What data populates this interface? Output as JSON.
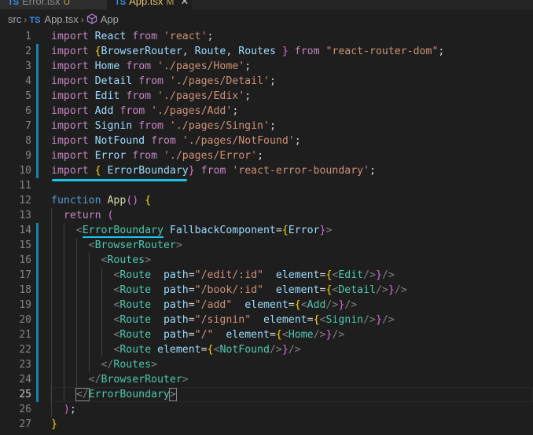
{
  "tabs": [
    {
      "label": "Error.tsx",
      "badge": "U",
      "active": false
    },
    {
      "label": "App.tsx",
      "badge": "M",
      "active": true
    }
  ],
  "breadcrumb": {
    "folder": "src",
    "file_badge": "TS",
    "file": "App.tsx",
    "symbol": "App"
  },
  "editor": {
    "current_line": 25,
    "lines": [
      {
        "n": "1",
        "text": "import React from 'react';"
      },
      {
        "n": "2",
        "text": "import {BrowserRouter, Route, Routes } from \"react-router-dom\";"
      },
      {
        "n": "3",
        "text": "import Home from './pages/Home';"
      },
      {
        "n": "4",
        "text": "import Detail from './pages/Detail';"
      },
      {
        "n": "5",
        "text": "import Edit from './pages/Edix';"
      },
      {
        "n": "6",
        "text": "import Add from './pages/Add';"
      },
      {
        "n": "7",
        "text": "import Signin from './pages/Singin';"
      },
      {
        "n": "8",
        "text": "import NotFound from './pages/NotFound';"
      },
      {
        "n": "9",
        "text": "import Error from './pages/Error';"
      },
      {
        "n": "10",
        "text": "import { ErrorBoundary} from 'react-error-boundary';"
      },
      {
        "n": "11",
        "text": ""
      },
      {
        "n": "12",
        "text": "function App() {"
      },
      {
        "n": "13",
        "text": "  return ("
      },
      {
        "n": "14",
        "text": "    <ErrorBoundary FallbackComponent={Error}>"
      },
      {
        "n": "15",
        "text": "      <BrowserRouter>"
      },
      {
        "n": "16",
        "text": "        <Routes>"
      },
      {
        "n": "17",
        "text": "          <Route  path=\"/edit/:id\"  element={<Edit/>}/>"
      },
      {
        "n": "18",
        "text": "          <Route  path=\"/book/:id\"  element={<Detail/>}/>"
      },
      {
        "n": "19",
        "text": "          <Route  path=\"/add\"  element={<Add/>}/>"
      },
      {
        "n": "20",
        "text": "          <Route  path=\"/signin\"  element={<Signin/>}/>"
      },
      {
        "n": "21",
        "text": "          <Route  path=\"/\"  element={<Home/>}/>"
      },
      {
        "n": "22",
        "text": "          <Route element={<NotFound/>}/>"
      },
      {
        "n": "23",
        "text": "        </Routes>"
      },
      {
        "n": "24",
        "text": "      </BrowserRouter>"
      },
      {
        "n": "25",
        "text": "    </ErrorBoundary>"
      },
      {
        "n": "26",
        "text": "  );"
      },
      {
        "n": "27",
        "text": "}"
      }
    ]
  },
  "colors": {
    "background": "#1e1e1e",
    "keyword": "#c586c0",
    "tag": "#4ec9b0",
    "string": "#ce9178",
    "function": "#dcdcaa",
    "annotation_underline": "#12c6ea",
    "modified_gutter": "#1b81a8"
  }
}
